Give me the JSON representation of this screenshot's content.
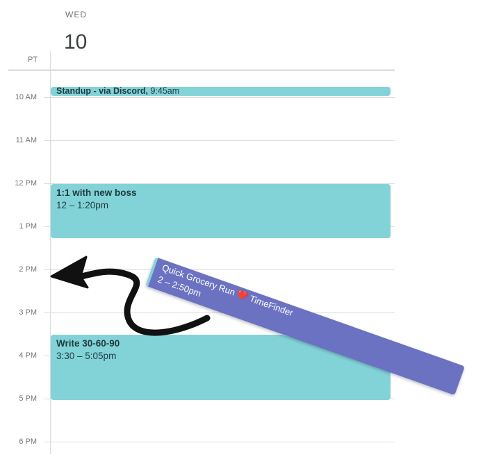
{
  "header": {
    "day_name": "WED",
    "day_number": "10",
    "timezone": "PT"
  },
  "hours": [
    "10 AM",
    "11 AM",
    "12 PM",
    "1 PM",
    "2 PM",
    "3 PM",
    "4 PM",
    "5 PM",
    "6 PM"
  ],
  "events": {
    "standup": {
      "title": "Standup - via Discord,",
      "time": " 9:45am",
      "color": "#82d3d8"
    },
    "boss": {
      "title": "1:1 with new boss",
      "time": "12 – 1:20pm",
      "color": "#82d3d8"
    },
    "write": {
      "title": "Write 30-60-90",
      "time": "3:30 – 5:05pm",
      "color": "#82d3d8"
    }
  },
  "dragging_event": {
    "title": "Quick Grocery Run",
    "heart_icon": "❤️",
    "suffix": "TimeFinder",
    "time": "2 – 2:50pm",
    "color": "#6b72c2"
  }
}
